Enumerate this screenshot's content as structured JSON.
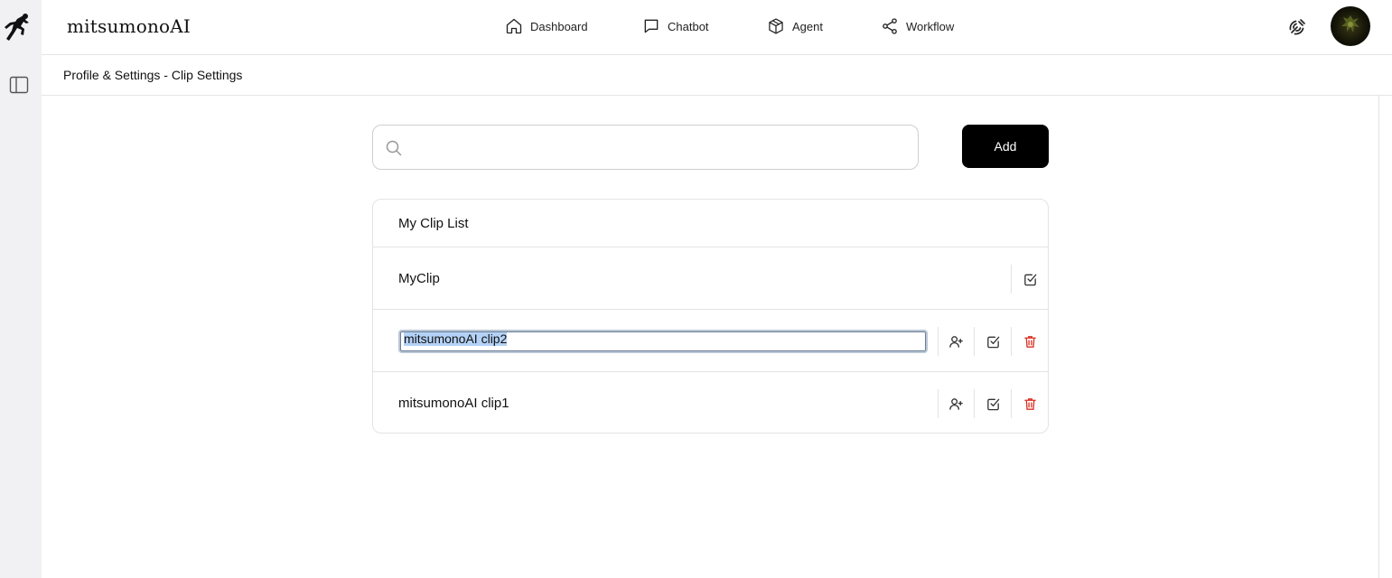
{
  "app": {
    "brand": "mitsumonoAI"
  },
  "nav": {
    "items": [
      {
        "label": "Dashboard",
        "icon": "home-icon"
      },
      {
        "label": "Chatbot",
        "icon": "chat-icon"
      },
      {
        "label": "Agent",
        "icon": "cube-icon"
      },
      {
        "label": "Workflow",
        "icon": "share-icon"
      }
    ]
  },
  "header": {
    "page_title": "Profile & Settings - Clip Settings"
  },
  "search": {
    "value": "",
    "placeholder": ""
  },
  "toolbar": {
    "add_label": "Add"
  },
  "clips": {
    "header": "My Clip List",
    "rows": [
      {
        "name": "MyClip",
        "editing": false,
        "actions": [
          "check-square-icon"
        ]
      },
      {
        "name": "mitsumonoAI clip2",
        "editing": true,
        "actions": [
          "add-user-icon",
          "check-square-icon",
          "trash-icon"
        ]
      },
      {
        "name": "mitsumonoAI clip1",
        "editing": false,
        "actions": [
          "add-user-icon",
          "check-square-icon",
          "trash-icon"
        ]
      }
    ]
  },
  "colors": {
    "accent": "#000000",
    "danger": "#d93025",
    "selection": "#b4d2f7",
    "rail": "#f1f1f4"
  }
}
